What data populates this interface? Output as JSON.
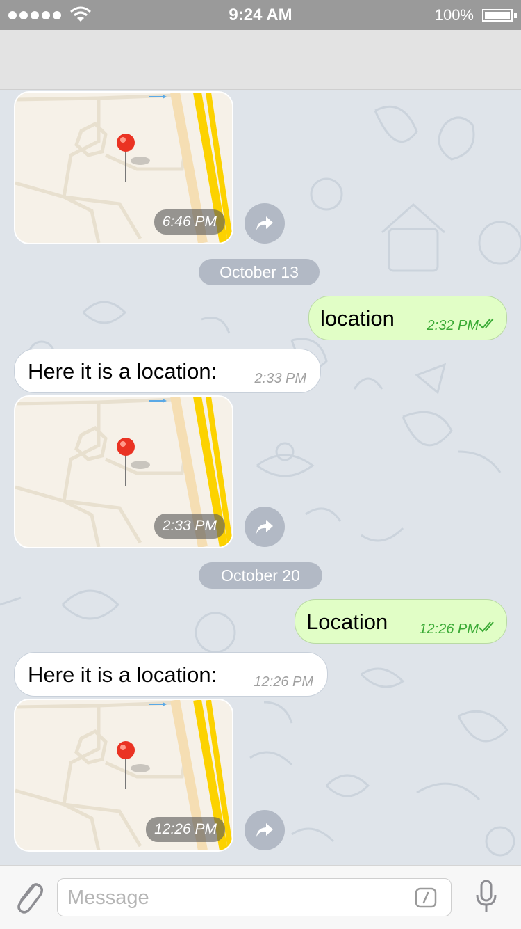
{
  "status_bar": {
    "time": "9:24 AM",
    "battery": "100%",
    "signal_dots": 5,
    "icons": [
      "signal-dots-icon",
      "wifi-icon",
      "battery-icon"
    ]
  },
  "colors": {
    "outgoing_bubble": "#e1fec6",
    "incoming_bubble": "#ffffff",
    "timestamp_green": "#3aaa35",
    "chat_background": "#dfe4ea"
  },
  "messages": {
    "map1": {
      "time": "6:46 PM"
    },
    "date1": "October 13",
    "out1": {
      "text": "location",
      "time": "2:32 PM"
    },
    "in1": {
      "text": "Here it is a location:",
      "time": "2:33 PM"
    },
    "map2": {
      "time": "2:33 PM"
    },
    "date2": "October 20",
    "out2": {
      "text": "Location",
      "time": "12:26 PM"
    },
    "in2": {
      "text": "Here it is a location:",
      "time": "12:26 PM"
    },
    "map3": {
      "time": "12:26 PM"
    }
  },
  "input": {
    "placeholder": "Message",
    "icons": [
      "paperclip-icon",
      "slash-command-icon",
      "microphone-icon"
    ]
  }
}
